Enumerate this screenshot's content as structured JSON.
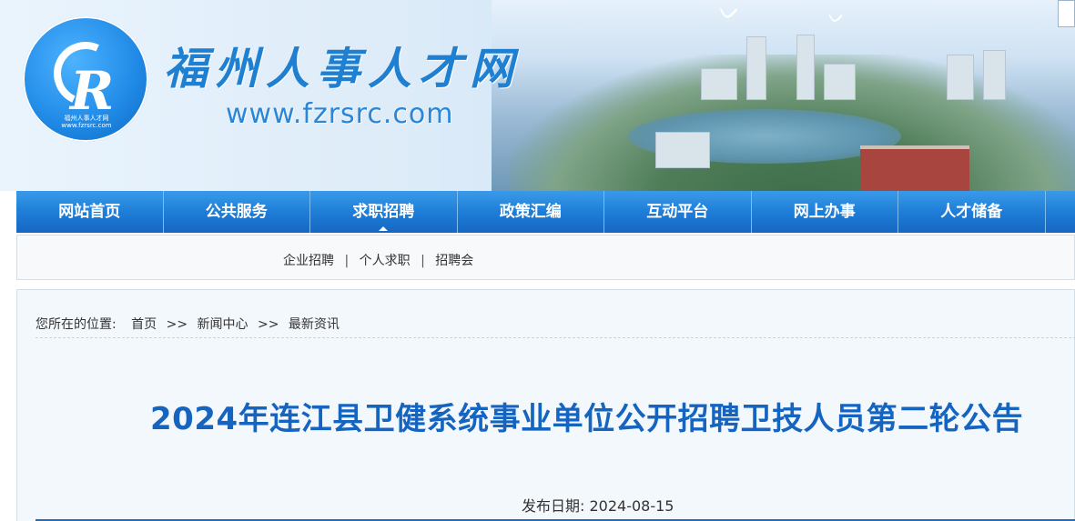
{
  "header": {
    "site_title": "福州人事人才网",
    "site_url": "www.fzrsrc.com",
    "logo_small_text": "福州人事人才网",
    "logo_small_url": "www.fzrsrc.com"
  },
  "nav": {
    "items": [
      {
        "label": "网站首页"
      },
      {
        "label": "公共服务"
      },
      {
        "label": "求职招聘"
      },
      {
        "label": "政策汇编"
      },
      {
        "label": "互动平台"
      },
      {
        "label": "网上办事"
      },
      {
        "label": "人才储备"
      }
    ],
    "active_index": 2
  },
  "subnav": {
    "items": [
      {
        "label": "企业招聘"
      },
      {
        "label": "个人求职"
      },
      {
        "label": "招聘会"
      }
    ],
    "separator": "|"
  },
  "breadcrumb": {
    "label": "您所在的位置:",
    "items": [
      {
        "label": "首页"
      },
      {
        "label": "新闻中心"
      },
      {
        "label": "最新资讯"
      }
    ],
    "arrow": ">>"
  },
  "article": {
    "title": "2024年连江县卫健系统事业单位公开招聘卫技人员第二轮公告",
    "publish_label": "发布日期:",
    "publish_date": "2024-08-15"
  },
  "colors": {
    "nav_blue": "#1e7ed8",
    "title_blue": "#1565c0",
    "logo_blue": "#1e88e5"
  }
}
